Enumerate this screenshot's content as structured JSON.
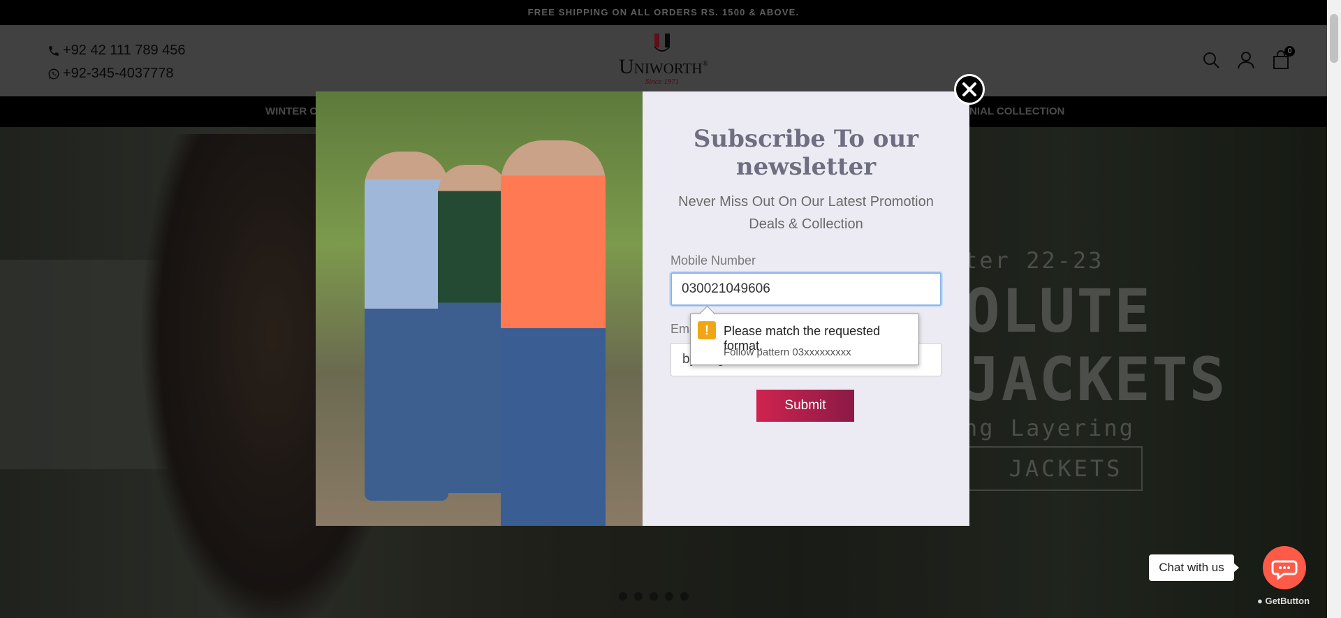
{
  "topbar": {
    "text": "FREE SHIPPING ON ALL ORDERS RS. 1500 & ABOVE."
  },
  "header": {
    "phone": "+92 42 111 789 456",
    "whatsapp": "+92-345-4037778",
    "logo_letter": "U",
    "brand": "Uniworth",
    "registered": "®",
    "since": "Since 1971",
    "cart_count": "0"
  },
  "nav": {
    "item_left": "WINTER C",
    "item_right": "NIAL COLLECTION"
  },
  "hero": {
    "season": "ter 22-23",
    "headline_1": "OLUTE",
    "headline_2": "JACKETS",
    "subline": "ng Layering",
    "button": "JACKETS"
  },
  "modal": {
    "title": "Subscribe To our newsletter",
    "subtitle": "Never Miss Out On Our Latest Promotion Deals & Collection",
    "mobile_label": "Mobile Number",
    "mobile_value": "030021049606",
    "email_label": "Ema",
    "email_value": "bykisrgmail.com",
    "submit_label": "Submit"
  },
  "tooltip": {
    "message": "Please match the requested format.",
    "hint": "Follow pattern 03xxxxxxxxx"
  },
  "chat": {
    "label": "Chat with us",
    "brand": "GetButton"
  },
  "colors": {
    "accent": "#c72150",
    "chat": "#ff5a48",
    "warning": "#f0a614",
    "focus": "#8bb4ea"
  },
  "icons": {
    "phone": "phone-icon",
    "whatsapp": "whatsapp-icon",
    "search": "search-icon",
    "account": "user-icon",
    "cart": "bag-icon",
    "close": "close-icon",
    "chat": "chat-bubble-icon",
    "warning": "warning-icon"
  }
}
